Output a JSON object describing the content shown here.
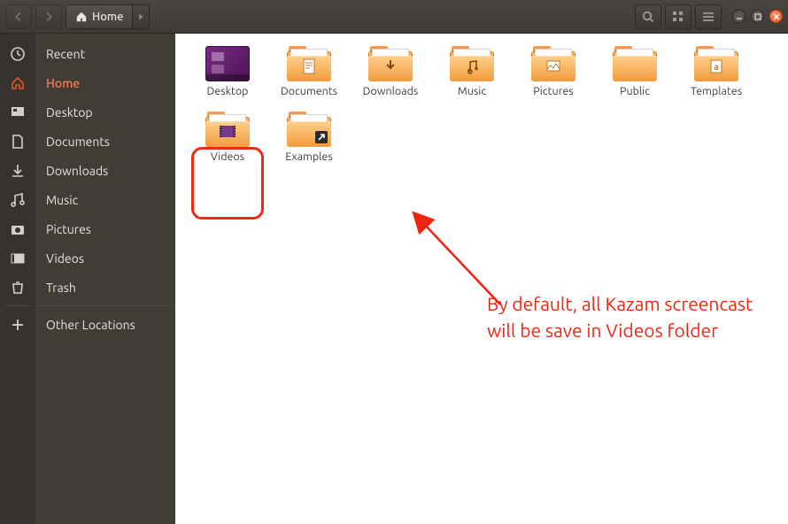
{
  "header": {
    "location_label": "Home"
  },
  "sidebar": {
    "items": [
      {
        "label": "Recent"
      },
      {
        "label": "Home"
      },
      {
        "label": "Desktop"
      },
      {
        "label": "Documents"
      },
      {
        "label": "Downloads"
      },
      {
        "label": "Music"
      },
      {
        "label": "Pictures"
      },
      {
        "label": "Videos"
      },
      {
        "label": "Trash"
      },
      {
        "label": "Other Locations"
      }
    ],
    "active_index": 1
  },
  "content": {
    "items": [
      {
        "label": "Desktop",
        "kind": "desktop"
      },
      {
        "label": "Documents",
        "kind": "folder",
        "glyph": "doc"
      },
      {
        "label": "Downloads",
        "kind": "folder",
        "glyph": "download"
      },
      {
        "label": "Music",
        "kind": "folder",
        "glyph": "music"
      },
      {
        "label": "Pictures",
        "kind": "folder",
        "glyph": "picture"
      },
      {
        "label": "Public",
        "kind": "folder",
        "glyph": "none"
      },
      {
        "label": "Templates",
        "kind": "folder",
        "glyph": "template"
      },
      {
        "label": "Videos",
        "kind": "folder",
        "glyph": "video"
      },
      {
        "label": "Examples",
        "kind": "folder",
        "glyph": "link"
      }
    ],
    "highlighted_index": 7
  },
  "annotation": {
    "text": "By default, all Kazam screencast\nwill be save in Videos folder"
  }
}
